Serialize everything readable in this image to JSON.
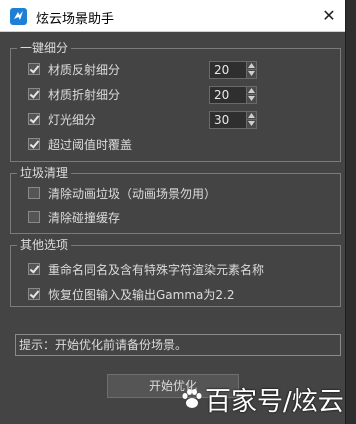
{
  "window": {
    "title": "炫云场景助手",
    "close_glyph": "✕"
  },
  "group_detail": {
    "legend": "一键细分",
    "items": [
      {
        "label": "材质反射细分",
        "checked": true,
        "value": "20"
      },
      {
        "label": "材质折射细分",
        "checked": true,
        "value": "20"
      },
      {
        "label": "灯光细分",
        "checked": true,
        "value": "30"
      },
      {
        "label": "超过阈值时覆盖",
        "checked": true
      }
    ]
  },
  "group_cleanup": {
    "legend": "垃圾清理",
    "items": [
      {
        "label": "清除动画垃圾（动画场景勿用）",
        "checked": false
      },
      {
        "label": "清除碰撞缓存",
        "checked": false
      }
    ]
  },
  "group_other": {
    "legend": "其他选项",
    "items": [
      {
        "label": "重命名同名及含有特殊字符渲染元素名称",
        "checked": true
      },
      {
        "label": "恢复位图输入及输出Gamma为2.2",
        "checked": true
      }
    ]
  },
  "hint": {
    "text": "提示：开始优化前请备份场景。"
  },
  "start_button": {
    "label": "开始优化"
  },
  "watermark": {
    "text": "百家号/炫云"
  },
  "icons": {
    "app": "xuanyun-logo-icon",
    "close": "close-icon",
    "spin_up": "spin-up-arrow-icon",
    "spin_down": "spin-down-arrow-icon",
    "watermark": "paw-icon"
  },
  "colors": {
    "dialog_bg": "#444444",
    "titlebar_bg": "#ffffff",
    "text": "#dcdcdc",
    "border": "#7a7a7a"
  }
}
